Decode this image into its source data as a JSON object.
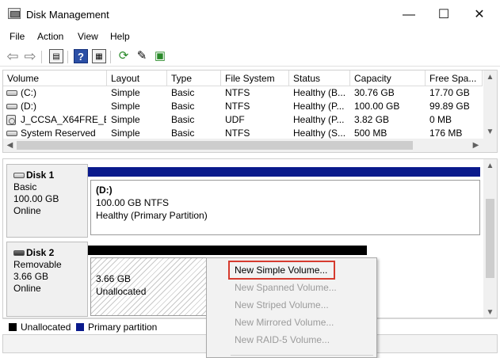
{
  "window": {
    "title": "Disk Management",
    "controls": {
      "minimize": "—",
      "maximize": "☐",
      "close": "✕"
    }
  },
  "menubar": [
    "File",
    "Action",
    "View",
    "Help"
  ],
  "toolbar": {
    "icons": [
      "back-arrow-icon",
      "forward-arrow-icon",
      "console-tree-icon",
      "help-icon",
      "properties-icon",
      "refresh-icon",
      "export-icon",
      "settings-icon"
    ],
    "help_glyph": "?"
  },
  "volume_list": {
    "columns": [
      "Volume",
      "Layout",
      "Type",
      "File System",
      "Status",
      "Capacity",
      "Free Spa..."
    ],
    "rows": [
      {
        "volume": "(C:)",
        "layout": "Simple",
        "type": "Basic",
        "fs": "NTFS",
        "status": "Healthy (B...",
        "capacity": "30.76 GB",
        "free": "17.70 GB",
        "icon": "drive-icon"
      },
      {
        "volume": "(D:)",
        "layout": "Simple",
        "type": "Basic",
        "fs": "NTFS",
        "status": "Healthy (P...",
        "capacity": "100.00 GB",
        "free": "99.89 GB",
        "icon": "drive-icon"
      },
      {
        "volume": "J_CCSA_X64FRE_E...",
        "layout": "Simple",
        "type": "Basic",
        "fs": "UDF",
        "status": "Healthy (P...",
        "capacity": "3.82 GB",
        "free": "0 MB",
        "icon": "cd-drive-icon"
      },
      {
        "volume": "System Reserved",
        "layout": "Simple",
        "type": "Basic",
        "fs": "NTFS",
        "status": "Healthy (S...",
        "capacity": "500 MB",
        "free": "176 MB",
        "icon": "drive-icon"
      }
    ]
  },
  "disks": [
    {
      "name": "Disk 1",
      "type": "Basic",
      "size": "100.00 GB",
      "state": "Online",
      "partition": {
        "label": "(D:)",
        "detail": "100.00 GB NTFS",
        "status": "Healthy (Primary Partition)",
        "bar_color": "#0a1a8c"
      }
    },
    {
      "name": "Disk 2",
      "type": "Removable",
      "size": "3.66 GB",
      "state": "Online",
      "partition": {
        "size": "3.66 GB",
        "status": "Unallocated",
        "bar_color": "#000000"
      }
    }
  ],
  "legend": [
    {
      "label": "Unallocated",
      "color": "#000000"
    },
    {
      "label": "Primary partition",
      "color": "#0a1a8c"
    }
  ],
  "context_menu": {
    "items": [
      {
        "label": "New Simple Volume...",
        "enabled": true
      },
      {
        "label": "New Spanned Volume...",
        "enabled": false
      },
      {
        "label": "New Striped Volume...",
        "enabled": false
      },
      {
        "label": "New Mirrored Volume...",
        "enabled": false
      },
      {
        "label": "New RAID-5 Volume...",
        "enabled": false
      }
    ],
    "highlight_color": "#d63b2f"
  },
  "scroll_arrows": {
    "up": "▲",
    "down": "▼",
    "left": "◀",
    "right": "▶"
  }
}
